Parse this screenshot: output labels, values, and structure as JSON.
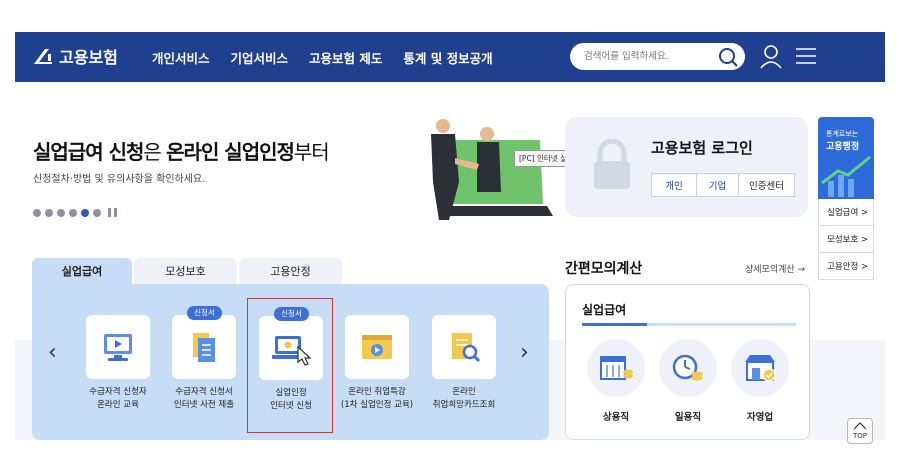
{
  "header": {
    "logo_text": "고용보험",
    "menu": [
      "개인서비스",
      "기업서비스",
      "고용보험 제도",
      "통계 및 정보공개"
    ],
    "search_placeholder": "검색어를 입력하세요.",
    "colors": {
      "gnb": "#1f3f8f",
      "accent": "#3e6fd8",
      "highlight": "#e0342a"
    }
  },
  "hero": {
    "title_a": "실업급여 신청",
    "title_b": "은 ",
    "title_c": "온라인 실업인정",
    "title_d": "부터",
    "subtitle": "신청절차·방법 및 유의사항을 확인하세요.",
    "tooltip": "[PC] 인터넷 실업인정 신청 관련 배너게시 새창으로 이동"
  },
  "login": {
    "title": "고용보험 로그인",
    "buttons": [
      "개인",
      "기업",
      "인증센터"
    ]
  },
  "side": {
    "banner_line1": "통계로보는",
    "banner_line2": "고용행정",
    "links": [
      "실업급여 >",
      "모성보호 >",
      "고용안정 >"
    ]
  },
  "tabs": [
    "실업급여",
    "모성보호",
    "고용안정"
  ],
  "services": [
    {
      "tag": "",
      "line1": "수급자격 신청자",
      "line2": "온라인 교육"
    },
    {
      "tag": "신청서",
      "line1": "수급자격 신청서",
      "line2": "인터넷 사전 제출"
    },
    {
      "tag": "신청서",
      "line1": "실업인정",
      "line2": "인터넷 신청"
    },
    {
      "tag": "",
      "line1": "온라인 취업특강",
      "line2": "(1차 실업인정 교육)"
    },
    {
      "tag": "",
      "line1": "온라인",
      "line2": "취업희망카드조회"
    }
  ],
  "calculator": {
    "title": "간편모의계산",
    "more": "상세모의계산 →",
    "box_title": "실업급여",
    "items": [
      "상용직",
      "일용직",
      "자영업"
    ]
  },
  "top_button": "TOP"
}
